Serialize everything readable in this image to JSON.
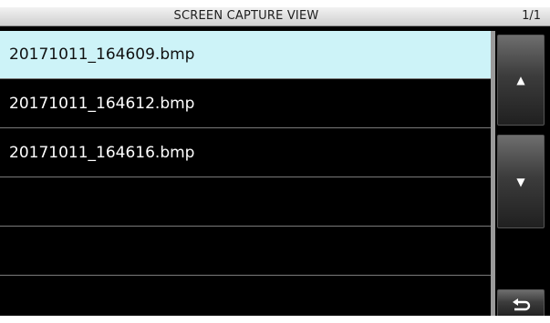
{
  "header": {
    "title": "SCREEN CAPTURE VIEW",
    "page_indicator": "1/1"
  },
  "file_list": {
    "items": [
      {
        "filename": "20171011_164609.bmp",
        "selected": true
      },
      {
        "filename": "20171011_164612.bmp",
        "selected": false
      },
      {
        "filename": "20171011_164616.bmp",
        "selected": false
      },
      {
        "filename": "",
        "selected": false
      },
      {
        "filename": "",
        "selected": false
      },
      {
        "filename": "",
        "selected": false
      }
    ]
  },
  "controls": {
    "scroll_up_icon": "triangle-up-icon",
    "scroll_down_icon": "triangle-down-icon",
    "back_icon": "return-arrow-icon"
  },
  "colors": {
    "selected_row_bg": "#cdf3f8",
    "screen_bg": "#000000",
    "title_bar_bg": "#e0e0e0"
  }
}
